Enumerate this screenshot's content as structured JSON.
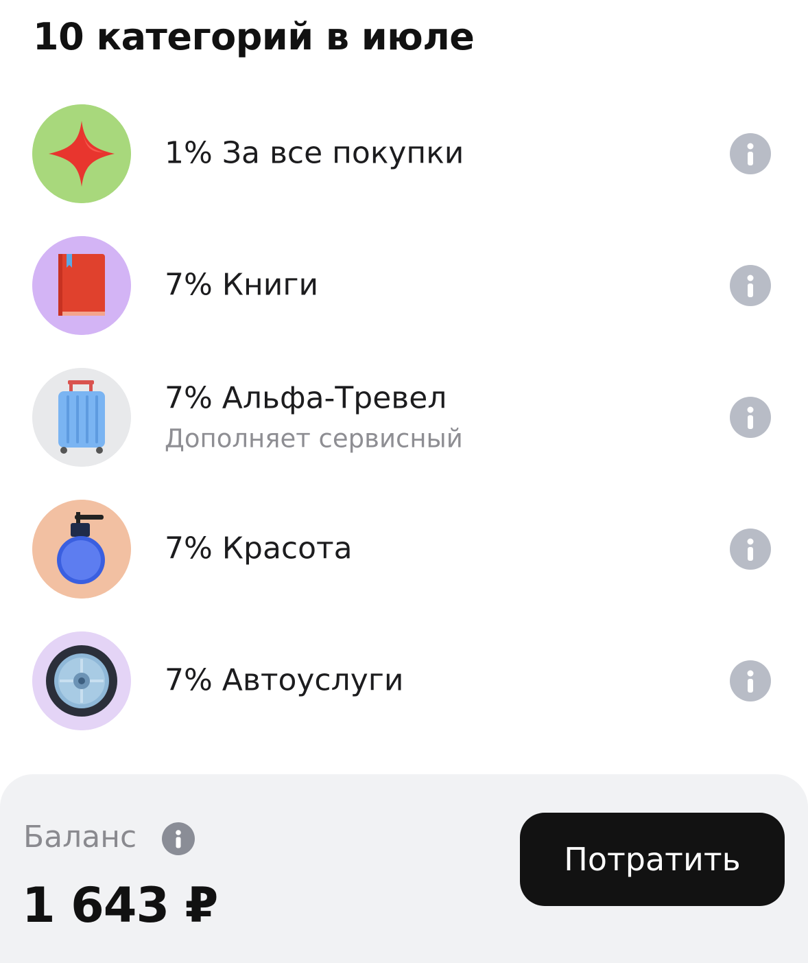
{
  "header": {
    "title": "10 категорий в июле"
  },
  "categories": [
    {
      "label": "1% За все покупки",
      "subtitle": "",
      "icon": "star-icon",
      "bg": "#a8d87c"
    },
    {
      "label": "7% Книги",
      "subtitle": "",
      "icon": "book-icon",
      "bg": "#d3b4f5"
    },
    {
      "label": "7% Альфа-Тревел",
      "subtitle": "Дополняет сервисный",
      "icon": "suitcase-icon",
      "bg": "#e8e9eb"
    },
    {
      "label": "7% Красота",
      "subtitle": "",
      "icon": "perfume-bottle-icon",
      "bg": "#f2c0a2"
    },
    {
      "label": "7% Автоуслуги",
      "subtitle": "",
      "icon": "car-wheel-icon",
      "bg": "#e4d4f6"
    }
  ],
  "balance": {
    "label": "Баланс",
    "amount": "1 643 ₽"
  },
  "actions": {
    "spend_label": "Потратить"
  },
  "colors": {
    "info_icon": "#b8bcc6",
    "button_bg": "#121212",
    "bottom_panel_bg": "#f1f2f4"
  }
}
